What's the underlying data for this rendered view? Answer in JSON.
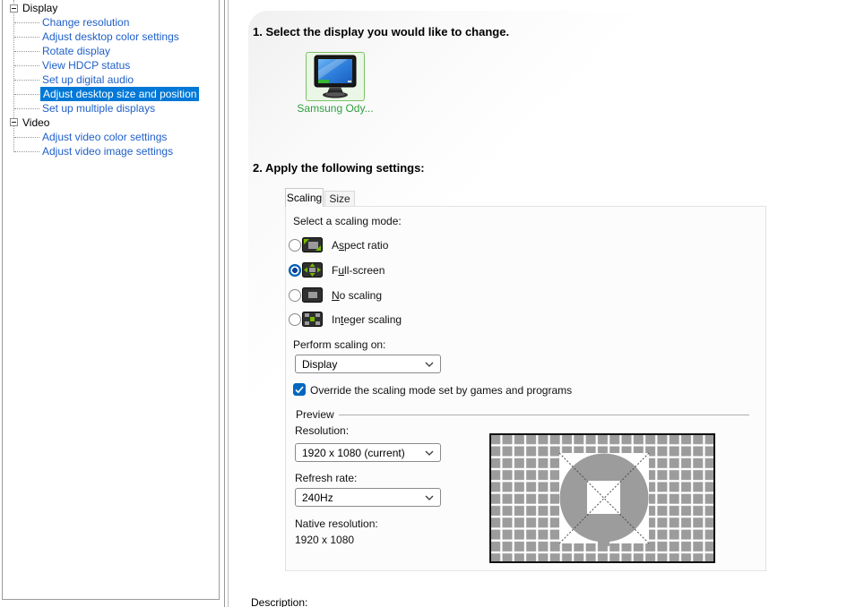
{
  "sidebar": {
    "groups": [
      {
        "label": "Display",
        "items": [
          "Change resolution",
          "Adjust desktop color settings",
          "Rotate display",
          "View HDCP status",
          "Set up digital audio",
          "Adjust desktop size and position",
          "Set up multiple displays"
        ]
      },
      {
        "label": "Video",
        "items": [
          "Adjust video color settings",
          "Adjust video image settings"
        ]
      }
    ],
    "selected_item": "Adjust desktop size and position"
  },
  "main": {
    "step1_heading": "1. Select the display you would like to change.",
    "display_name": "Samsung Ody...",
    "step2_heading": "2. Apply the following settings:",
    "tabs": [
      {
        "label": "Scaling"
      },
      {
        "label": "Size"
      }
    ],
    "scaling": {
      "section_label": "Select a scaling mode:",
      "modes": [
        {
          "pre": "A",
          "key": "s",
          "post": "pect ratio",
          "selected": false
        },
        {
          "pre": "F",
          "key": "u",
          "post": "ll-screen",
          "selected": true
        },
        {
          "pre": "",
          "key": "N",
          "post": "o scaling",
          "selected": false
        },
        {
          "pre": "In",
          "key": "t",
          "post": "eger scaling",
          "selected": false
        }
      ],
      "perform_on_label": "Perform scaling on:",
      "perform_on_value": "Display",
      "override_label": "Override the scaling mode set by games and programs",
      "override_checked": true
    },
    "preview": {
      "group_label": "Preview",
      "resolution_label": "Resolution:",
      "resolution_value": "1920 x 1080 (current)",
      "refresh_label": "Refresh rate:",
      "refresh_value": "240Hz",
      "native_label": "Native resolution:",
      "native_value": "1920 x 1080"
    },
    "description_label": "Description:"
  },
  "colors": {
    "accent": "#0067c0",
    "selected_bg": "#0078d7",
    "tree_link": "#2060c8",
    "nvidia_green": "#76b900",
    "display_label_green": "#2f9e3f"
  }
}
